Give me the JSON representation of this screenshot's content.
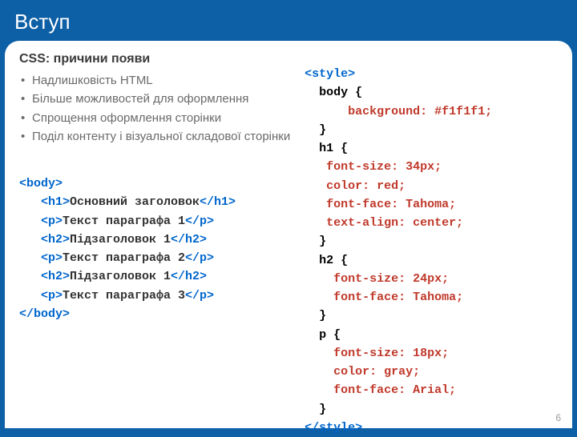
{
  "header": {
    "title": "Вступ"
  },
  "subtitle": "CSS: причини появи",
  "bullets": [
    "Надлишковість HTML",
    "Більше можливостей для оформлення",
    "Спрощення оформлення сторінки",
    "Поділ контенту і візуальної складової сторінки"
  ],
  "code_left": {
    "l1a": "<body>",
    "l2a": "   <h1>",
    "l2b": "Основний заголовок",
    "l2c": "</h1>",
    "l3a": "   <p>",
    "l3b": "Текст параграфа 1",
    "l3c": "</p>",
    "l4a": "   <h2>",
    "l4b": "Підзаголовок 1",
    "l4c": "</h2>",
    "l5a": "   <p>",
    "l5b": "Текст параграфа 2",
    "l5c": "</p>",
    "l6a": "   <h2>",
    "l6b": "Підзаголовок 1",
    "l6c": "</h2>",
    "l7a": "   <p>",
    "l7b": "Текст параграфа 3",
    "l7c": "</p>",
    "l8a": "</body>"
  },
  "code_right": {
    "r1": "<style>",
    "r2": "  body {",
    "r3": "      background: #f1f1f1;",
    "r4": "  }",
    "r5": "  h1 {",
    "r6": "   font-size: 34px;",
    "r7": "   color: red;",
    "r8": "   font-face: Tahoma;",
    "r9": "   text-align: center;",
    "r10": "  }",
    "r11": "  h2 {",
    "r12": "    font-size: 24px;",
    "r13": "    font-face: Tahoma;",
    "r14": "  }",
    "r15": "  p {",
    "r16": "    font-size: 18px;",
    "r17": "    color: gray;",
    "r18": "    font-face: Arial;",
    "r19": "  }",
    "r20": "</style>"
  },
  "page_number": "6"
}
